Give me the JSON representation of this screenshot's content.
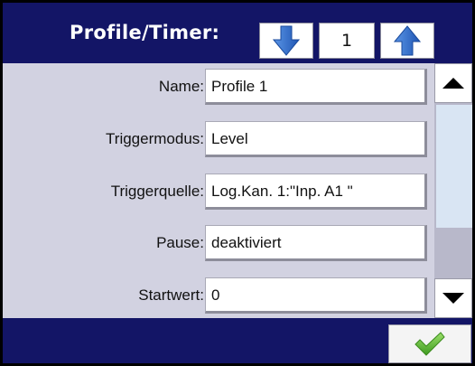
{
  "header": {
    "title": "Profile/Timer:",
    "profile_number": "1",
    "down_icon": "arrow-down-icon",
    "up_icon": "arrow-up-icon"
  },
  "fields": [
    {
      "label": "Name:",
      "value": "Profile 1"
    },
    {
      "label": "Triggermodus:",
      "value": "Level"
    },
    {
      "label": "Triggerquelle:",
      "value": "Log.Kan. 1:\"Inp. A1 \""
    },
    {
      "label": "Pause:",
      "value": "deaktiviert"
    },
    {
      "label": "Startwert:",
      "value": "0"
    }
  ],
  "scrollbar": {
    "up_icon": "triangle-up-icon",
    "down_icon": "triangle-down-icon"
  },
  "footer": {
    "confirm_icon": "checkmark-icon"
  },
  "colors": {
    "header_bg": "#131566",
    "content_bg": "#d2d2e1",
    "arrow_blue": "#2f6fd0",
    "check_green": "#5cb832"
  }
}
